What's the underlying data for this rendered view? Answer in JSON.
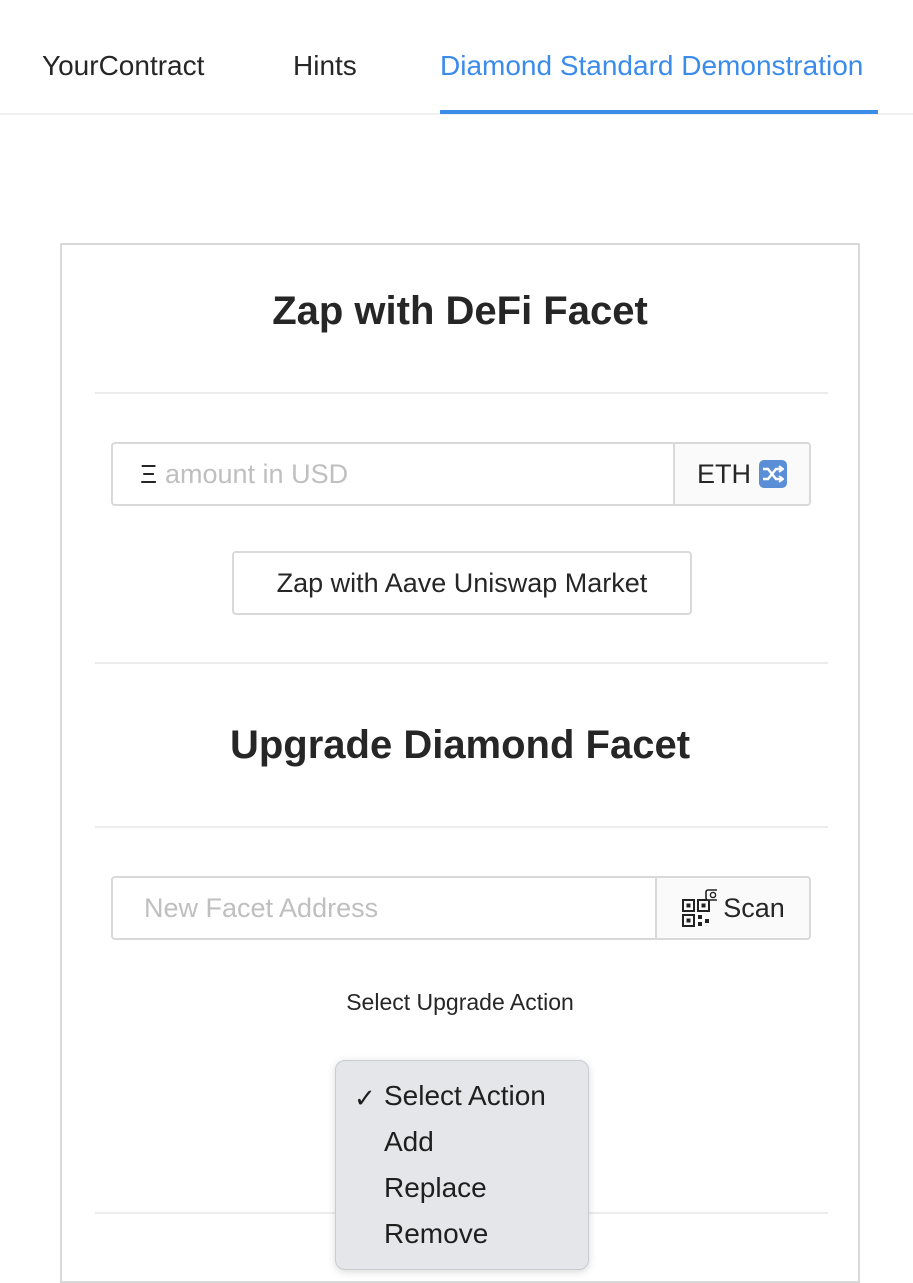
{
  "tabs": [
    {
      "label": "YourContract"
    },
    {
      "label": "Hints"
    },
    {
      "label": "Diamond Standard Demonstration"
    }
  ],
  "colors": {
    "accent": "#3b8beb",
    "border": "#d9d9d9"
  },
  "zap": {
    "title": "Zap with DeFi Facet",
    "prefix": "Ξ",
    "placeholder": "amount in USD",
    "currency": "ETH",
    "currency_icon": "shuffle-icon",
    "button": "Zap with Aave Uniswap Market"
  },
  "upgrade": {
    "title": "Upgrade Diamond Facet",
    "address_placeholder": "New Facet Address",
    "scan_label": "Scan",
    "scan_icon": "qr-scan-icon",
    "action_label": "Select Upgrade Action",
    "options": [
      "Select Action",
      "Add",
      "Replace",
      "Remove"
    ],
    "selected": "Select Action"
  }
}
